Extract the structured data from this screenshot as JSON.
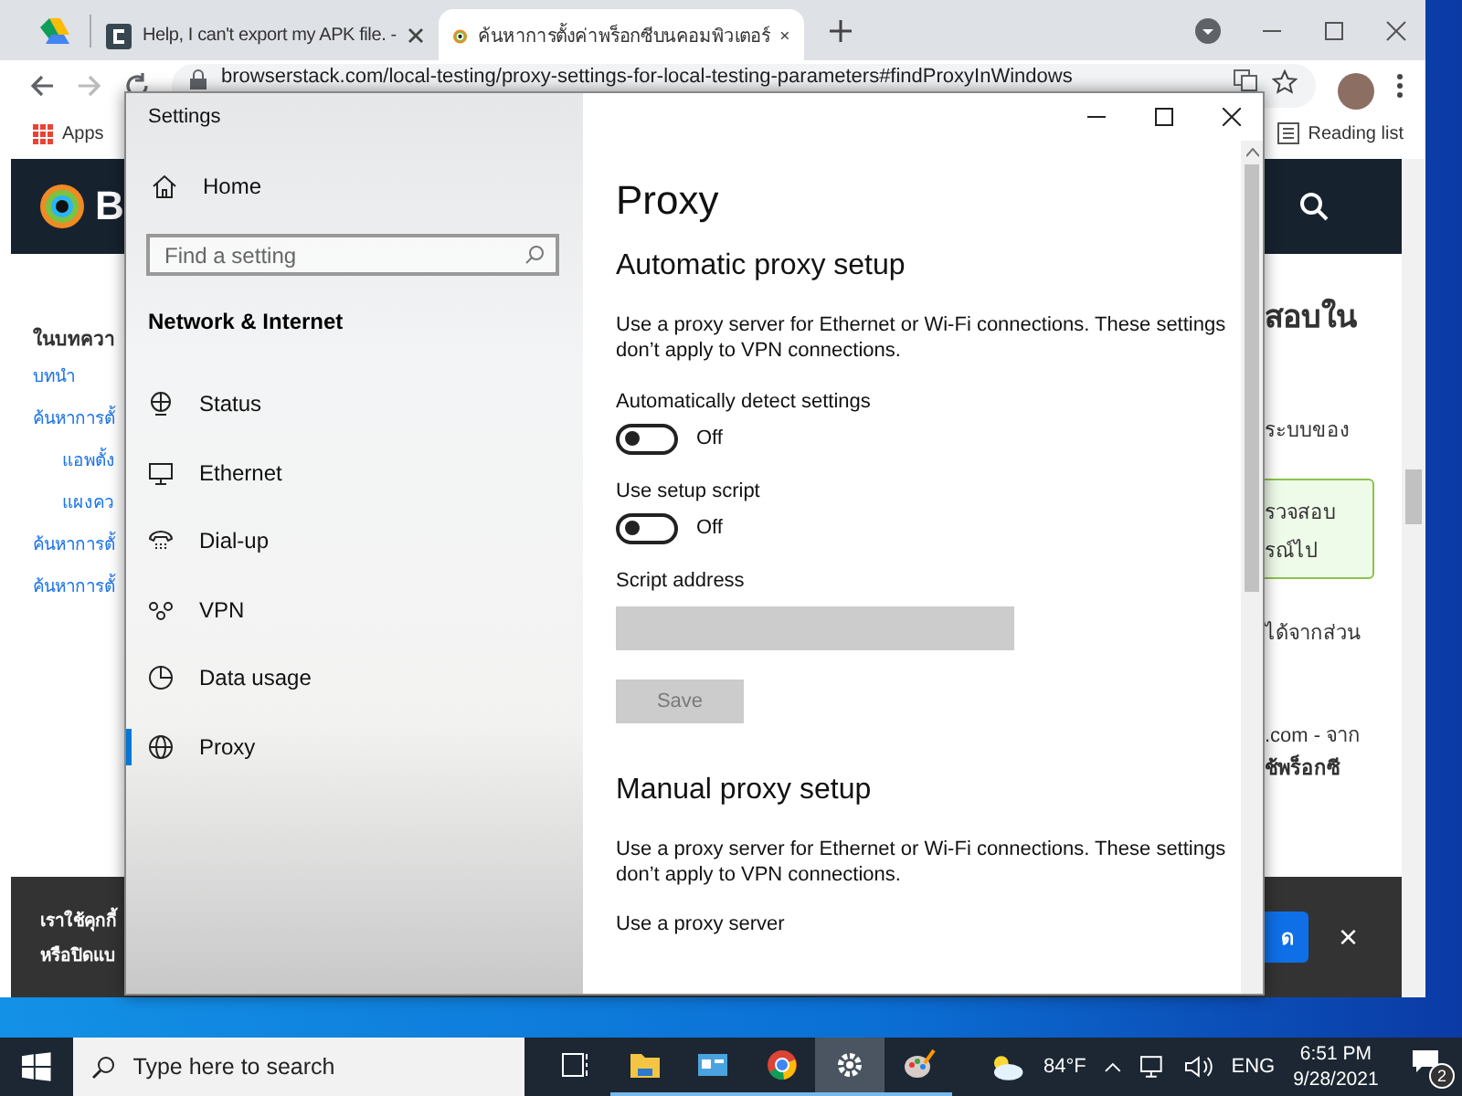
{
  "browser": {
    "tabs": [
      {
        "kind": "icon-only",
        "selected": false
      },
      {
        "kind": "titled",
        "title": "Help, I can't export my APK file. -",
        "selected": false
      },
      {
        "kind": "titled",
        "title": "ค้นหาการตั้งค่าพร็อกซีบนคอมพิวเตอร์",
        "selected": true
      }
    ],
    "address": "browserstack.com/local-testing/proxy-settings-for-local-testing-parameters#findProxyInWindows",
    "bookmarks": {
      "apps": "Apps",
      "reading_list": "Reading list"
    },
    "page": {
      "brand": "B",
      "toc_heading": "ในบทควา",
      "toc": [
        {
          "label": "บทนำ"
        },
        {
          "label": "ค้นหาการตั้",
          "children": [
            {
              "label": "แอพตั้ง"
            },
            {
              "label": "แผงคว"
            }
          ]
        },
        {
          "label": "ค้นหาการตั้"
        },
        {
          "label": "ค้นหาการตั้"
        }
      ],
      "heading": "สอบใน",
      "paragraph_1": "ระบบของ",
      "note_lines": [
        "รวจสอบ",
        "รณ์ไป"
      ],
      "paragraph_2": "ได้จากส่วน",
      "paragraph_3": ".com - จาก",
      "paragraph_3_bold": "ช้พร็อกซี"
    },
    "cookie_bar": {
      "lines": [
        "เราใช้คุกกี้",
        "หรือปิดแบ"
      ],
      "button": "ด",
      "close": "×"
    }
  },
  "settings": {
    "title": "Settings",
    "home": "Home",
    "search_placeholder": "Find a setting",
    "section": "Network & Internet",
    "nav": [
      {
        "kind": "status",
        "label": "Status",
        "selected": false
      },
      {
        "kind": "ethernet",
        "label": "Ethernet",
        "selected": false
      },
      {
        "kind": "dialup",
        "label": "Dial-up",
        "selected": false
      },
      {
        "kind": "vpn",
        "label": "VPN",
        "selected": false
      },
      {
        "kind": "data",
        "label": "Data usage",
        "selected": false
      },
      {
        "kind": "proxy",
        "label": "Proxy",
        "selected": true
      }
    ],
    "page_title": "Proxy",
    "groups": [
      {
        "heading": "Automatic proxy setup",
        "description": "Use a proxy server for Ethernet or Wi-Fi connections. These settings don’t apply to VPN connections.",
        "items": [
          {
            "kind": "toggle",
            "label": "Automatically detect settings",
            "on": false,
            "state_text": "Off"
          },
          {
            "kind": "toggle",
            "label": "Use setup script",
            "on": false,
            "state_text": "Off"
          },
          {
            "kind": "field",
            "label": "Script address",
            "disabled": true
          },
          {
            "kind": "button",
            "label": "Save",
            "disabled": true
          }
        ]
      },
      {
        "heading": "Manual proxy setup",
        "description": "Use a proxy server for Ethernet or Wi-Fi connections. These settings don’t apply to VPN connections.",
        "items": [
          {
            "kind": "label",
            "label": "Use a proxy server"
          }
        ]
      }
    ]
  },
  "taskbar": {
    "search_placeholder": "Type here to search",
    "apps": [
      {
        "kind": "taskview",
        "selected": false,
        "running": false
      },
      {
        "kind": "folder",
        "selected": false,
        "running": true
      },
      {
        "kind": "control",
        "selected": false,
        "running": true
      },
      {
        "kind": "browser",
        "selected": false,
        "running": true
      },
      {
        "kind": "gear",
        "selected": true,
        "running": true
      },
      {
        "kind": "paint",
        "selected": false,
        "running": true
      }
    ],
    "temperature": "84°F",
    "language": "ENG",
    "time": "6:51 PM",
    "date": "9/28/2021",
    "notifications": "2"
  }
}
